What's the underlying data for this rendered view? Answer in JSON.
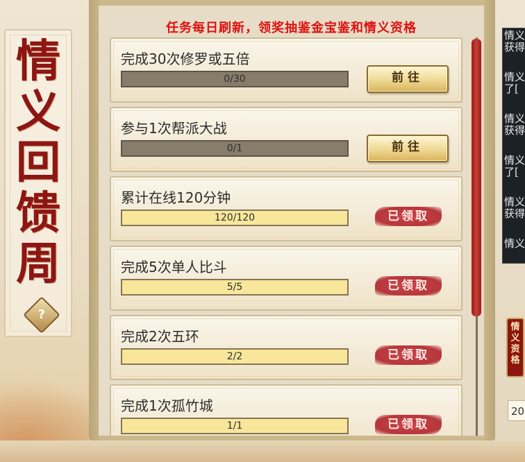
{
  "banner": {
    "title": [
      "情",
      "义",
      "回",
      "馈",
      "周"
    ],
    "help_label": "?"
  },
  "panel": {
    "notice": "任务每日刷新，领奖抽鉴金宝鉴和情义资格"
  },
  "tasks": [
    {
      "title": "完成30次修罗或五倍",
      "progress_text": "0/30",
      "progress": 0,
      "action": "前往",
      "state": "go"
    },
    {
      "title": "参与1次帮派大战",
      "progress_text": "0/1",
      "progress": 0,
      "action": "前往",
      "state": "go"
    },
    {
      "title": "累计在线120分钟",
      "progress_text": "120/120",
      "progress": 1,
      "action": "已领取",
      "state": "claimed"
    },
    {
      "title": "完成5次单人比斗",
      "progress_text": "5/5",
      "progress": 1,
      "action": "已领取",
      "state": "claimed"
    },
    {
      "title": "完成2次五环",
      "progress_text": "2/2",
      "progress": 1,
      "action": "已领取",
      "state": "claimed"
    },
    {
      "title": "完成1次孤竹城",
      "progress_text": "1/1",
      "progress": 1,
      "action": "已领取",
      "state": "claimed"
    }
  ],
  "side": {
    "chat_lines": [
      "情义",
      "获得",
      "情义",
      "了[",
      "情义",
      "获得",
      "情义",
      "了[",
      "情义",
      "获得",
      "情义"
    ],
    "badge": "情义资格",
    "year": "20"
  }
}
